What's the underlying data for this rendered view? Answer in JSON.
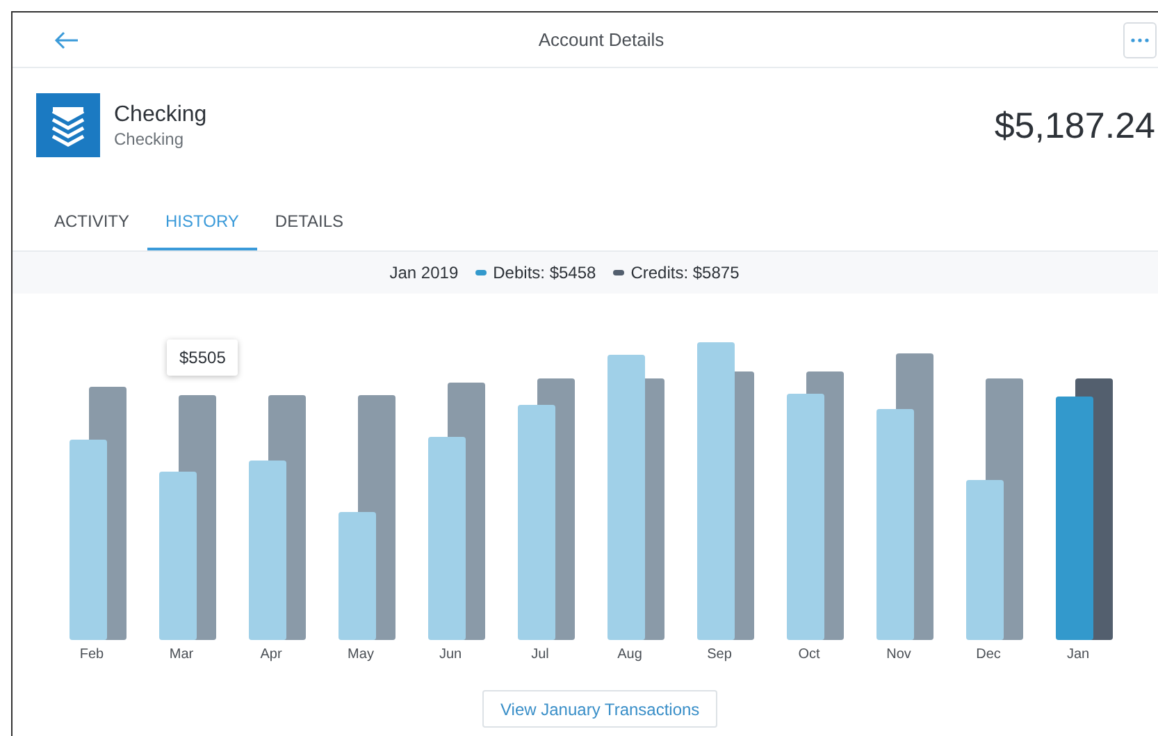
{
  "header": {
    "title": "Account Details"
  },
  "account": {
    "name": "Checking",
    "type": "Checking",
    "balance": "$5,187.24"
  },
  "tabs": [
    {
      "label": "ACTIVITY",
      "selected": false
    },
    {
      "label": "HISTORY",
      "selected": true
    },
    {
      "label": "DETAILS",
      "selected": false
    }
  ],
  "legend": {
    "period": "Jan 2019",
    "series": [
      {
        "label": "Debits: $5458",
        "color": "#3399cc"
      },
      {
        "label": "Credits: $5875",
        "color": "#535f6e"
      }
    ]
  },
  "chart": {
    "tooltip": "$5505",
    "months": [
      {
        "label": "Feb",
        "selected": false
      },
      {
        "label": "Mar",
        "selected": false
      },
      {
        "label": "Apr",
        "selected": false
      },
      {
        "label": "May",
        "selected": false
      },
      {
        "label": "Jun",
        "selected": false
      },
      {
        "label": "Jul",
        "selected": false
      },
      {
        "label": "Aug",
        "selected": false
      },
      {
        "label": "Sep",
        "selected": false
      },
      {
        "label": "Oct",
        "selected": false
      },
      {
        "label": "Nov",
        "selected": false
      },
      {
        "label": "Dec",
        "selected": false
      },
      {
        "label": "Jan",
        "selected": true
      }
    ]
  },
  "action_button": "View January Transactions"
}
